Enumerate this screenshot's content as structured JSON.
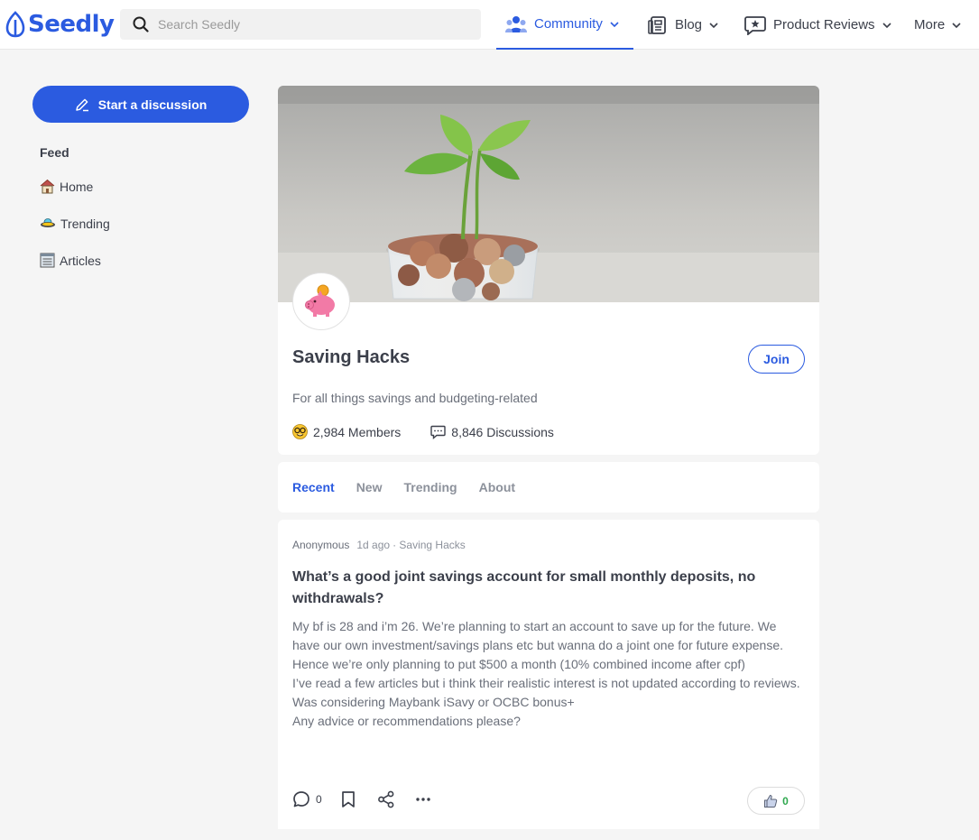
{
  "header": {
    "logo_text": "Seedly",
    "search_placeholder": "Search Seedly",
    "nav": [
      {
        "label": "Community",
        "icon": "community-icon"
      },
      {
        "label": "Blog",
        "icon": "blog-icon"
      },
      {
        "label": "Product Reviews",
        "icon": "review-icon"
      },
      {
        "label": "More"
      }
    ]
  },
  "sidebar": {
    "start_label": "Start a discussion",
    "feed_title": "Feed",
    "items": [
      {
        "label": "Home",
        "icon": "house-icon"
      },
      {
        "label": "Trending",
        "icon": "ufo-icon"
      },
      {
        "label": "Articles",
        "icon": "newspaper-icon"
      }
    ]
  },
  "community": {
    "name": "Saving Hacks",
    "join_label": "Join",
    "description": "For all things savings and budgeting-related",
    "members": "2,984 Members",
    "discussions": "8,846 Discussions"
  },
  "tabs": [
    "Recent",
    "New",
    "Trending",
    "About"
  ],
  "post": {
    "author": "Anonymous",
    "time": "1d ago",
    "community": "· Saving Hacks",
    "title": "What’s a good joint savings account for small monthly deposits, no withdrawals?",
    "body": [
      "My bf is 28 and i’m 26. We’re planning to start an account to save up for the future. We have our own investment/savings plans etc but wanna do a joint one for future expense. Hence we’re only planning to put $500 a month (10% combined income after cpf)",
      "I’ve read a few articles but i think their realistic interest is not updated according to reviews.",
      "Was considering Maybank iSavy or OCBC bonus+",
      "Any advice or recommendations please?"
    ],
    "comment_count": "0",
    "upvotes": "0"
  },
  "colors": {
    "brand": "#2b5be0",
    "upvote": "#2fa84f"
  }
}
